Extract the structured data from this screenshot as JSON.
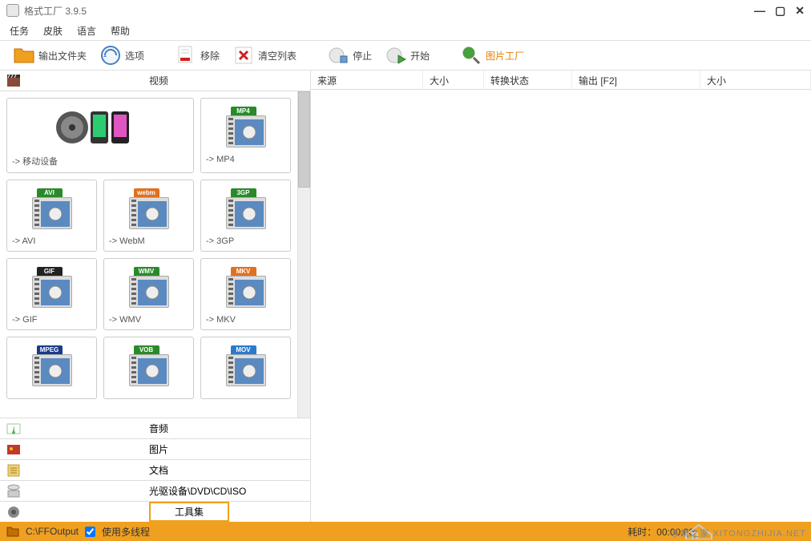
{
  "title": "格式工厂  3.9.5",
  "menubar": [
    "任务",
    "皮肤",
    "语言",
    "帮助"
  ],
  "toolbar": {
    "output_folder": "输出文件夹",
    "options": "选项",
    "remove": "移除",
    "clear_list": "清空列表",
    "stop": "停止",
    "start": "开始",
    "image_factory": "图片工厂"
  },
  "categories": {
    "video": "视频",
    "audio": "音频",
    "image": "图片",
    "document": "文档",
    "dvd": "光驱设备\\DVD\\CD\\ISO",
    "tools": "工具集"
  },
  "video_formats": [
    {
      "label": "-> 移动设备",
      "wide": true,
      "graphic": "mobile"
    },
    {
      "label": "-> MP4",
      "tab": "MP4",
      "tabColor": "#2a8a2a"
    },
    {
      "label": "-> AVI",
      "tab": "AVI",
      "tabColor": "#2a8a2a"
    },
    {
      "label": "-> WebM",
      "tab": "webm",
      "tabColor": "#e07020"
    },
    {
      "label": "-> 3GP",
      "tab": "3GP",
      "tabColor": "#2a8a2a"
    },
    {
      "label": "-> GIF",
      "tab": "GIF",
      "tabColor": "#222"
    },
    {
      "label": "-> WMV",
      "tab": "WMV",
      "tabColor": "#2a8a2a"
    },
    {
      "label": "-> MKV",
      "tab": "MKV",
      "tabColor": "#e07020"
    },
    {
      "label": "",
      "tab": "MPEG",
      "tabColor": "#1a3a8a"
    },
    {
      "label": "",
      "tab": "VOB",
      "tabColor": "#2a8a2a"
    },
    {
      "label": "",
      "tab": "MOV",
      "tabColor": "#2a7acc"
    }
  ],
  "table_headers": {
    "source": "来源",
    "size": "大小",
    "status": "转换状态",
    "output": "输出  [F2]",
    "out_size": "大小"
  },
  "statusbar": {
    "path": "C:\\FFOutput",
    "multithread": "使用多线程",
    "elapsed": "耗时：00:00:00"
  },
  "watermark": "系统之家  XITONGZHIJIA.NET"
}
